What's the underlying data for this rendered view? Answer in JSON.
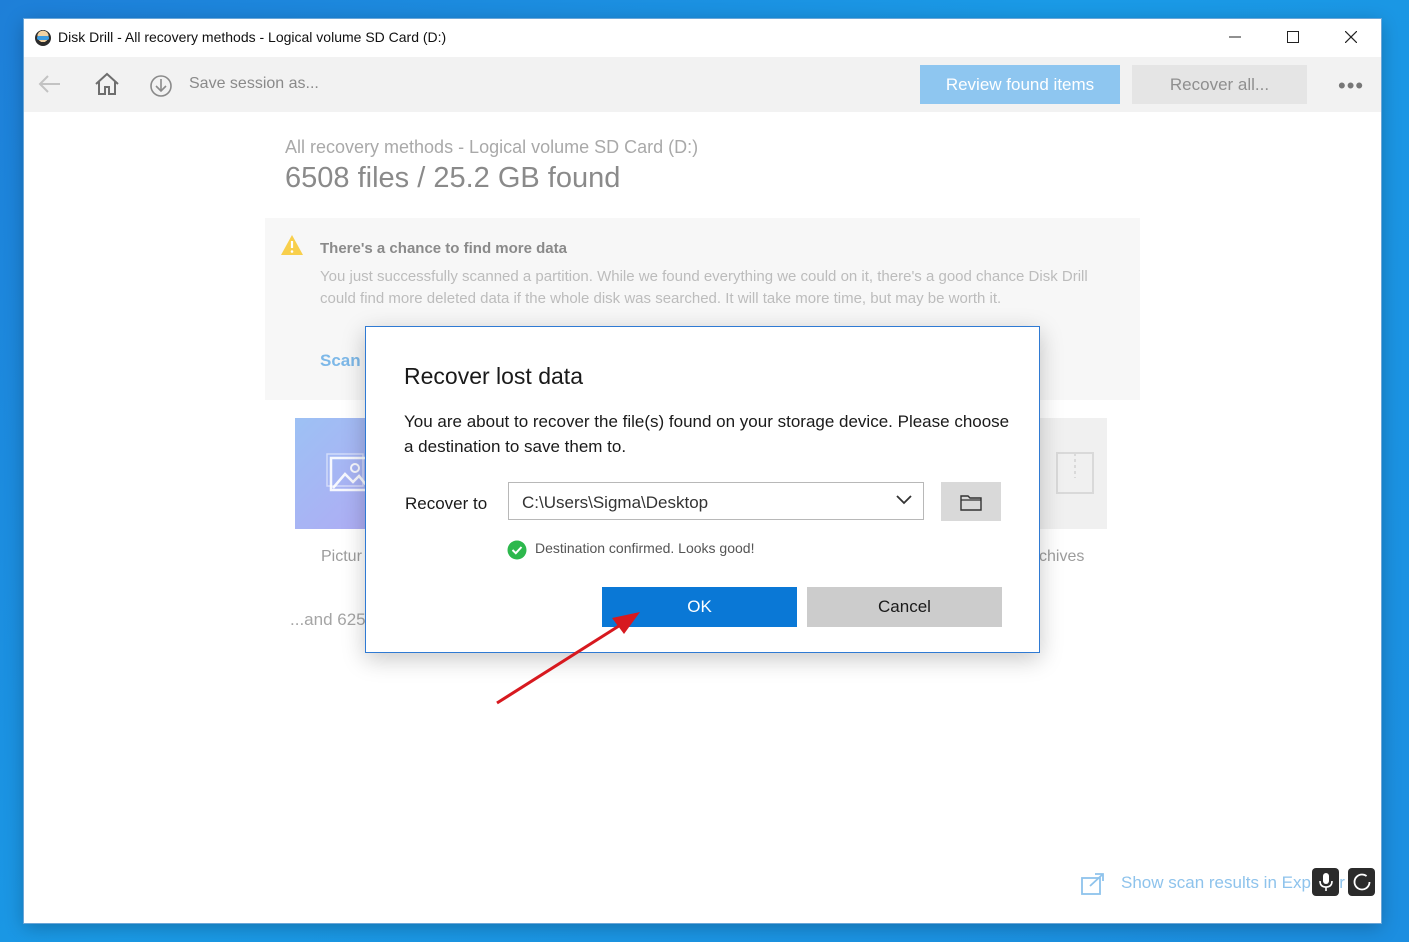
{
  "window": {
    "title": "Disk Drill - All recovery methods - Logical volume SD Card (D:)"
  },
  "toolbar": {
    "save_label": "Save session as...",
    "review_label": "Review found items",
    "recover_all_label": "Recover all...",
    "more_label": "•••"
  },
  "main": {
    "subtitle": "All recovery methods - Logical volume SD Card (D:)",
    "summary": "6508 files / 25.2 GB found",
    "notice": {
      "title": "There's a chance to find more data",
      "body": "You just successfully scanned a partition. While we found everything we could on it, there's a good chance Disk Drill could find more deleted data if the whole disk was searched. It will take more time, but may be worth it.",
      "link": "Scan"
    },
    "tiles": [
      {
        "label": "Pictur"
      },
      {
        "label": "chives"
      }
    ],
    "and_more": "...and 625",
    "show_results": "Show scan results in Explorer"
  },
  "dialog": {
    "title": "Recover lost data",
    "message": "You are about to recover the file(s) found on your storage device. Please choose a destination to save them to.",
    "recover_to_label": "Recover to",
    "destination": "C:\\Users\\Sigma\\Desktop",
    "confirmation": "Destination confirmed. Looks good!",
    "ok_label": "OK",
    "cancel_label": "Cancel"
  },
  "colors": {
    "accent": "#0a78d6",
    "review_button": "#8ec6f0",
    "dialog_border": "#2f7ad3",
    "confirm_green": "#2db84d",
    "annotation_red": "#d7191f"
  },
  "icons": [
    "app-icon",
    "back-arrow-icon",
    "home-icon",
    "download-icon",
    "warning-icon",
    "picture-icon",
    "archive-icon",
    "chevron-down-icon",
    "folder-icon",
    "check-circle-icon",
    "external-link-icon",
    "microphone-icon",
    "refresh-icon"
  ]
}
